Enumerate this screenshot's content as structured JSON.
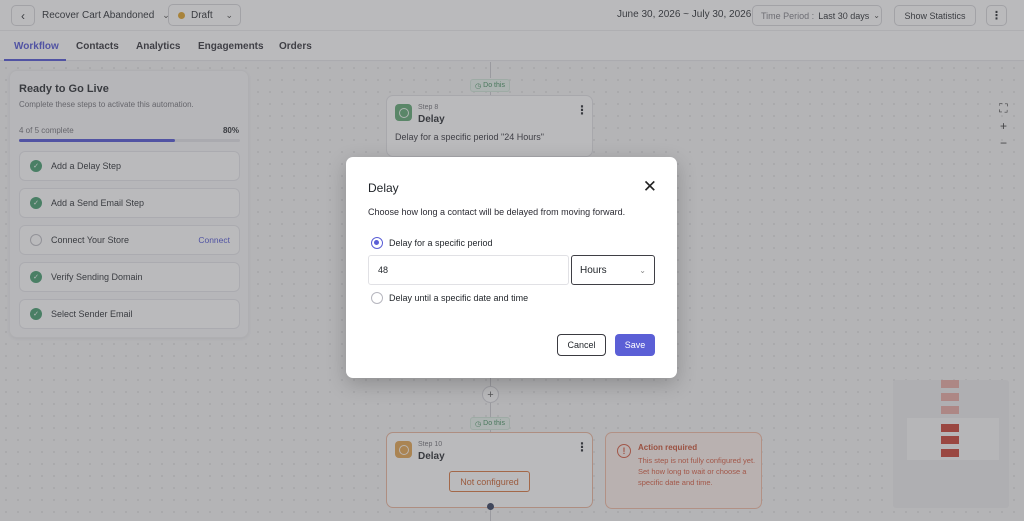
{
  "header": {
    "automation_name": "Recover Cart Abandoned",
    "status": "Draft",
    "date_range": "June 30, 2026 ~ July 30, 2026",
    "time_period_label": "Time Period :",
    "time_period_value": "Last 30 days",
    "show_statistics": "Show Statistics"
  },
  "tabs": [
    "Workflow",
    "Contacts",
    "Analytics",
    "Engagements",
    "Orders"
  ],
  "ready_panel": {
    "title": "Ready to Go Live",
    "subtitle": "Complete these steps to activate this automation.",
    "progress_label": "4 of 5 complete",
    "progress_pct": "80%",
    "progress_value": 0.8,
    "items": [
      {
        "label": "Add a Delay Step",
        "done": true
      },
      {
        "label": "Add a Send Email Step",
        "done": true
      },
      {
        "label": "Connect Your Store",
        "done": false,
        "link": "Connect"
      },
      {
        "label": "Verify Sending Domain",
        "done": true
      },
      {
        "label": "Select Sender Email",
        "done": true
      }
    ]
  },
  "workflow": {
    "do_this": "Do this",
    "step8": {
      "step_label": "Step 8",
      "title": "Delay",
      "description": "Delay for a specific period \"24 Hours\""
    },
    "step10": {
      "step_label": "Step 10",
      "title": "Delay",
      "badge": "Not configured"
    },
    "action_required": {
      "title": "Action required",
      "body": "This step is not fully configured yet. Set how long to wait or choose a specific date and time."
    }
  },
  "modal": {
    "title": "Delay",
    "subtitle": "Choose how long a contact will be delayed from moving forward.",
    "option_period": "Delay for a specific period",
    "option_until": "Delay until a specific date and time",
    "amount_value": "48",
    "unit_value": "Hours",
    "cancel": "Cancel",
    "save": "Save"
  },
  "colors": {
    "accent": "#5b5fd6",
    "success": "#3e9a6a",
    "warning": "#d6553a",
    "draft": "#e0a020"
  },
  "icons": [
    "chevron-left-icon",
    "chevron-down-icon",
    "kebab-icon",
    "check-icon",
    "fullscreen-icon",
    "plus-icon",
    "minus-icon",
    "close-icon",
    "alert-icon",
    "delay-icon"
  ]
}
